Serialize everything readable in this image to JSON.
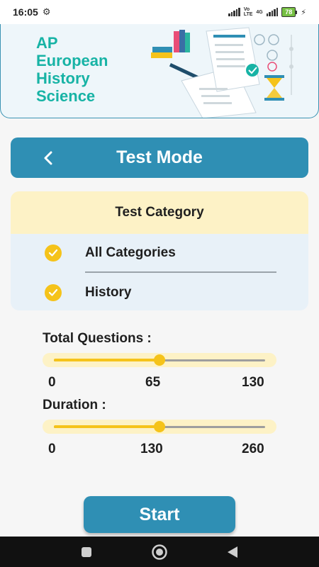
{
  "status_bar": {
    "time": "16:05",
    "battery": "78",
    "net_badge_top": "Vo",
    "net_badge_bottom": "LTE",
    "net_badge_4g": "4G"
  },
  "banner": {
    "title_lines": [
      "AP",
      "European",
      "History",
      "Science"
    ]
  },
  "header": {
    "title": "Test Mode"
  },
  "category": {
    "heading": "Test Category",
    "items": [
      {
        "label": "All Categories",
        "checked": true
      },
      {
        "label": "History",
        "checked": true
      }
    ]
  },
  "total_questions": {
    "label": "Total Questions :",
    "min": "0",
    "current": "65",
    "max": "130",
    "fraction": 0.5
  },
  "duration": {
    "label": "Duration :",
    "min": "0",
    "current": "130",
    "max": "260",
    "fraction": 0.5
  },
  "start_button": {
    "label": "Start"
  },
  "colors": {
    "primary": "#2f8fb4",
    "accent": "#f5c31a",
    "teal_title": "#17b3a5",
    "card_header": "#fdf2c6",
    "card_bg": "#e8f1f8"
  },
  "icons": {
    "back": "chevron-left-icon",
    "check": "check-circle-icon",
    "nav": [
      "square-icon",
      "circle-icon",
      "triangle-back-icon"
    ]
  }
}
